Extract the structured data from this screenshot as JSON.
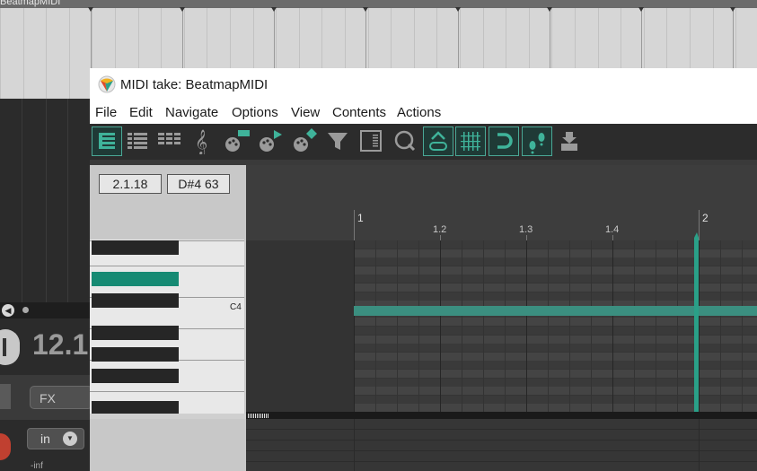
{
  "arrange": {
    "item_title": "BeatmapMIDI",
    "time_display": "12.1",
    "fx_label": "FX",
    "input_label": "in",
    "inf_label": "-inf"
  },
  "window": {
    "title": "MIDI take: BeatmapMIDI"
  },
  "menu": [
    "File",
    "Edit",
    "Navigate",
    "Options",
    "View",
    "Contents",
    "Actions"
  ],
  "toolbar": {
    "icons": [
      "piano-roll-view-icon",
      "named-notes-view-icon",
      "event-list-view-icon",
      "musical-notation-view-icon",
      "color-notes-by-velocity-icon",
      "color-notes-by-channel-icon",
      "color-notes-by-pitch-icon",
      "filter-icon",
      "list-icon",
      "quantize-icon",
      "link-selection-icon",
      "grid-icon",
      "snap-magnet-icon",
      "step-input-icon",
      "insert-note-icon"
    ],
    "accent_color": "#4aa896"
  },
  "info": {
    "position": "2.1.18",
    "note": "D#4  63"
  },
  "piano": {
    "c4_label": "C4",
    "highlight_color": "#168a73"
  },
  "ruler": {
    "bar1": "1",
    "beat2": "1.2",
    "beat3": "1.3",
    "beat4": "1.4",
    "bar2": "2"
  }
}
